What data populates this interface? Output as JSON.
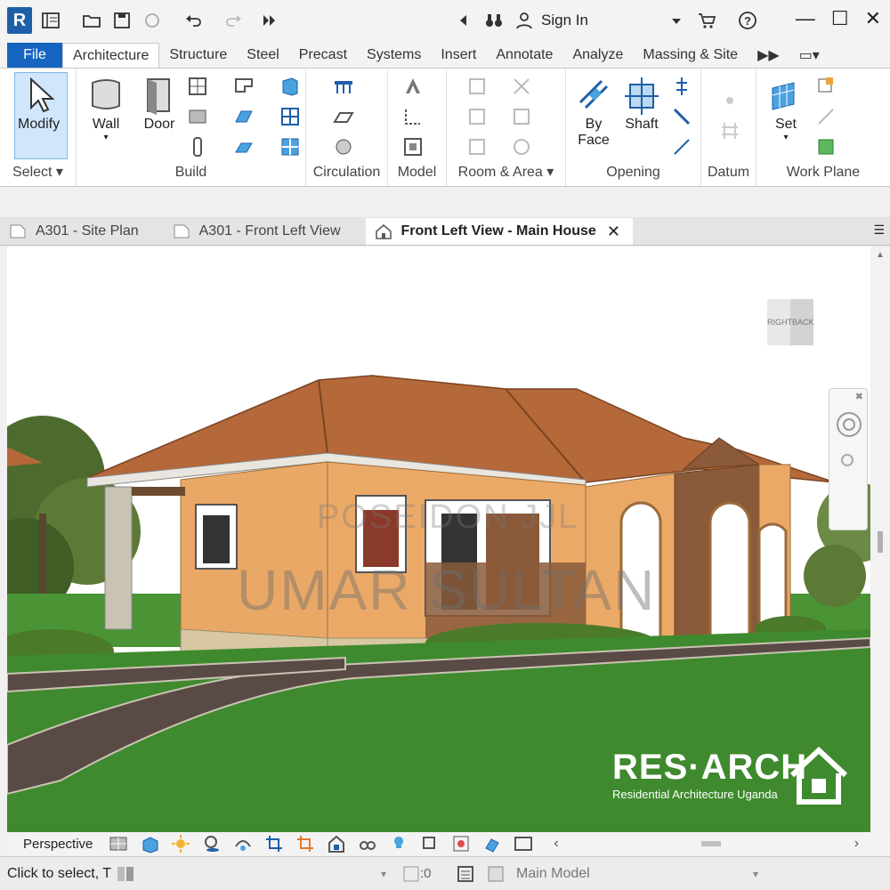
{
  "app": {
    "logo_letter": "R"
  },
  "header": {
    "sign_in": "Sign In"
  },
  "tabs": [
    "File",
    "Architecture",
    "Structure",
    "Steel",
    "Precast",
    "Systems",
    "Insert",
    "Annotate",
    "Analyze",
    "Massing & Site"
  ],
  "active_tab": "Architecture",
  "ribbon": {
    "modify": "Modify",
    "wall": "Wall",
    "door": "Door",
    "by_face_1": "By",
    "by_face_2": "Face",
    "shaft": "Shaft",
    "set": "Set",
    "panels": {
      "select": "Select",
      "build": "Build",
      "circulation": "Circulation",
      "model": "Model",
      "room_area": "Room & Area",
      "opening": "Opening",
      "datum": "Datum",
      "work_plane": "Work Plane"
    }
  },
  "view_tabs": [
    {
      "label": "A301 - Site Plan"
    },
    {
      "label": "A301 - Front Left View"
    },
    {
      "label": "Front Left View - Main House"
    }
  ],
  "viewcube": {
    "left": "RIGHT",
    "right": "BACK"
  },
  "watermark": {
    "line1": "POSEIDON JJL",
    "line2": "UMAR SULTAN"
  },
  "brand": {
    "name": "RES·ARCH",
    "tagline": "Residential Architecture Uganda"
  },
  "view_control": {
    "mode": "Perspective"
  },
  "status": {
    "hint": "Click to select, T",
    "zero": ":0",
    "model": "Main Model"
  },
  "colors": {
    "file_tab": "#1565c0",
    "grass": "#3f8a2e",
    "roof": "#b5683a",
    "wall": "#e9a865",
    "accent": "#1d5fa8"
  }
}
